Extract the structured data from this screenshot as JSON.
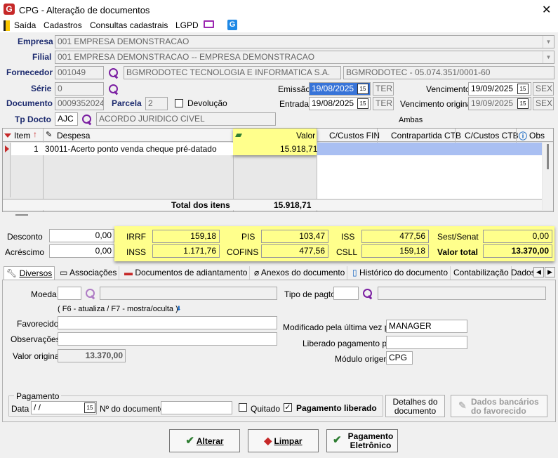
{
  "window": {
    "title": "CPG - Alteração de documentos"
  },
  "menu": {
    "items": [
      "Saída",
      "Cadastros",
      "Consultas cadastrais",
      "LGPD"
    ]
  },
  "form": {
    "empresa_label": "Empresa",
    "empresa_value": "001 EMPRESA DEMONSTRACAO",
    "filial_label": "Filial",
    "filial_value": "001 EMPRESA DEMONSTRACAO -- EMPRESA DEMONSTRACAO",
    "fornecedor_label": "Fornecedor",
    "fornecedor_code": "001049",
    "fornecedor_name": "BGMRODOTEC TECNOLOGIA E INFORMATICA S.A.",
    "fornecedor_doc": "BGMRODOTEC - 05.074.351/0001-60",
    "serie_label": "Série",
    "serie_value": "0",
    "documento_label": "Documento",
    "documento_value": "0009352024",
    "parcela_label": "Parcela",
    "parcela_value": "2",
    "devolucao_label": "Devolução",
    "tpdocto_label": "Tp Docto",
    "tpdocto_code": "AJC",
    "tpdocto_name": "ACORDO JURIDICO CIVEL",
    "emissao_label": "Emissão",
    "emissao_value": "19/08/2025",
    "emissao_day": "TER",
    "entrada_label": "Entrada",
    "entrada_value": "19/08/2025",
    "entrada_day": "TER",
    "vencimento_label": "Vencimento",
    "vencimento_value": "19/09/2025",
    "vencimento_day": "SEX",
    "venc_original_label": "Vencimento original",
    "venc_original_value": "19/09/2025",
    "venc_original_day": "SEX",
    "ambas_label": "Ambas",
    "cal_icon_text": "15"
  },
  "grid": {
    "headers": {
      "item": "Item",
      "despesa": "Despesa",
      "valor": "Valor",
      "cc_fin": "C/Custos FIN",
      "contrapartida": "Contrapartida CTB",
      "cc_ctb": "C/Custos CTB",
      "obs": "Obs"
    },
    "row": {
      "item": "1",
      "despesa": "30011-Acerto ponto venda cheque pré-datado",
      "valor": "15.918,71"
    },
    "total_label": "Total dos itens",
    "total_value": "15.918,71"
  },
  "taxes": {
    "desconto_label": "Desconto",
    "desconto_value": "0,00",
    "acrescimo_label": "Acréscimo",
    "acrescimo_value": "0,00",
    "irrf_label": "IRRF",
    "irrf_value": "159,18",
    "inss_label": "INSS",
    "inss_value": "1.171,76",
    "pis_label": "PIS",
    "pis_value": "103,47",
    "cofins_label": "COFINS",
    "cofins_value": "477,56",
    "iss_label": "ISS",
    "iss_value": "477,56",
    "csll_label": "CSLL",
    "csll_value": "159,18",
    "sest_label": "Sest/Senat",
    "sest_value": "0,00",
    "total_label": "Valor total",
    "total_value": "13.370,00"
  },
  "tabs": [
    "Diversos",
    "Associações",
    "Documentos de adiantamento",
    "Anexos do documento",
    "Histórico do documento",
    "Contabilização",
    "Dados"
  ],
  "diversos": {
    "moeda_label": "Moeda",
    "f6_hint": "( F6 - atualiza / F7 - mostra/oculta )",
    "favorecido_label": "Favorecido",
    "observacoes_label": "Observações",
    "valor_original_label": "Valor original",
    "valor_original_value": "13.370,00",
    "tipo_pagto_label": "Tipo de pagto",
    "modificado_label": "Modificado pela última vez por",
    "modificado_value": "MANAGER",
    "liberado_label": "Liberado pagamento por",
    "modulo_label": "Módulo origem",
    "modulo_value": "CPG"
  },
  "pagamento": {
    "group_label": "Pagamento",
    "data_label": "Data",
    "data_value": " /  /",
    "ndoc_label": "Nº do documento",
    "quitado_label": "Quitado",
    "liberado_label": "Pagamento liberado",
    "detalhes_button": "Detalhes do documento",
    "dados_bancarios_button": "Dados bancários do favorecido"
  },
  "footer": {
    "alterar": "Alterar",
    "limpar": "Limpar",
    "pagamento_eletronico": "Pagamento Eletrônico"
  },
  "colors": {
    "highlight": "#ffff8c",
    "selection": "#3874d8",
    "label_blue": "#1c2a6e",
    "accent_purple": "#7b1fa2"
  }
}
